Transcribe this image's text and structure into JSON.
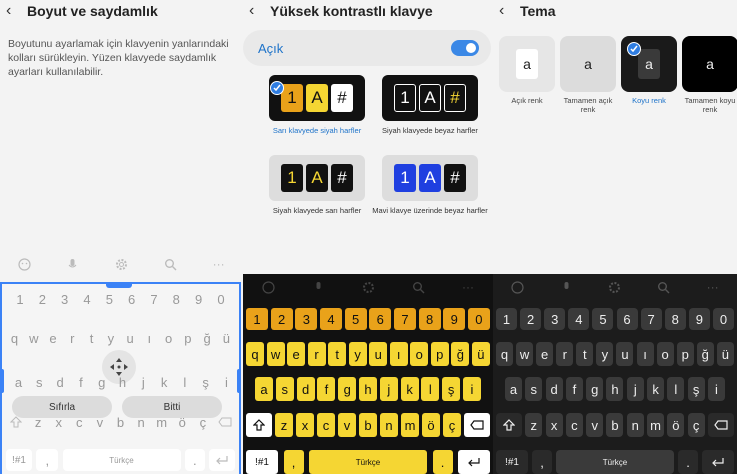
{
  "panel1": {
    "title": "Boyut ve saydamlık",
    "description": "Boyutunu ayarlamak için klavyenin yanlarındaki kolları sürükleyin. Yüzen klavyede saydamlık ayarları kullanılabilir.",
    "keyboard": {
      "numbers": [
        "1",
        "2",
        "3",
        "4",
        "5",
        "6",
        "7",
        "8",
        "9",
        "0"
      ],
      "row1": [
        "q",
        "w",
        "e",
        "r",
        "t",
        "y",
        "u",
        "ı",
        "o",
        "p",
        "ğ",
        "ü"
      ],
      "row2": [
        "a",
        "s",
        "d",
        "f",
        "g",
        "h",
        "j",
        "k",
        "l",
        "ş",
        "i"
      ],
      "row3": [
        "z",
        "x",
        "c",
        "v",
        "b",
        "n",
        "m",
        "ö",
        "ç"
      ],
      "reset_label": "Sıfırla",
      "done_label": "Bitti",
      "sym_label": "!#1",
      "space_label": "Türkçe"
    }
  },
  "panel2": {
    "title": "Yüksek kontrastlı klavye",
    "toggle_label": "Açık",
    "toggle_on": true,
    "preview_keys": [
      "1",
      "A",
      "#"
    ],
    "themes": [
      {
        "caption": "Sarı klavyede siyah harfler",
        "selected": true
      },
      {
        "caption": "Siyah klavyede beyaz harfler",
        "selected": false
      },
      {
        "caption": "Siyah klavyede sarı harfler",
        "selected": false
      },
      {
        "caption": "Mavi klavye üzerinde beyaz harfler",
        "selected": false
      }
    ],
    "keyboard": {
      "numbers": [
        "1",
        "2",
        "3",
        "4",
        "5",
        "6",
        "7",
        "8",
        "9",
        "0"
      ],
      "row1": [
        "q",
        "w",
        "e",
        "r",
        "t",
        "y",
        "u",
        "ı",
        "o",
        "p",
        "ğ",
        "ü"
      ],
      "row2": [
        "a",
        "s",
        "d",
        "f",
        "g",
        "h",
        "j",
        "k",
        "l",
        "ş",
        "i"
      ],
      "row3": [
        "z",
        "x",
        "c",
        "v",
        "b",
        "n",
        "m",
        "ö",
        "ç"
      ],
      "sym_label": "!#1",
      "comma_label": ",",
      "space_label": "Türkçe"
    }
  },
  "panel3": {
    "title": "Tema",
    "cards": [
      {
        "key": "a",
        "caption": "Açık renk",
        "selected": false
      },
      {
        "key": "a",
        "caption": "Tamamen açık renk",
        "selected": false
      },
      {
        "key": "a",
        "caption": "Koyu renk",
        "selected": true
      },
      {
        "key": "a",
        "caption": "Tamamen koyu renk",
        "selected": false
      }
    ],
    "keyboard": {
      "numbers": [
        "1",
        "2",
        "3",
        "4",
        "5",
        "6",
        "7",
        "8",
        "9",
        "0"
      ],
      "row1": [
        "q",
        "w",
        "e",
        "r",
        "t",
        "y",
        "u",
        "ı",
        "o",
        "p",
        "ğ",
        "ü"
      ],
      "row2": [
        "a",
        "s",
        "d",
        "f",
        "g",
        "h",
        "j",
        "k",
        "l",
        "ş",
        "i"
      ],
      "row3": [
        "z",
        "x",
        "c",
        "v",
        "b",
        "n",
        "m",
        "ö",
        "ç"
      ],
      "sym_label": "!#1",
      "space_label": "Türkçe"
    }
  },
  "colors": {
    "accent": "#2f7de1",
    "yellow_key": "#f5d633",
    "orange_key": "#e9a21a",
    "dark_key": "#3a3a3a"
  }
}
